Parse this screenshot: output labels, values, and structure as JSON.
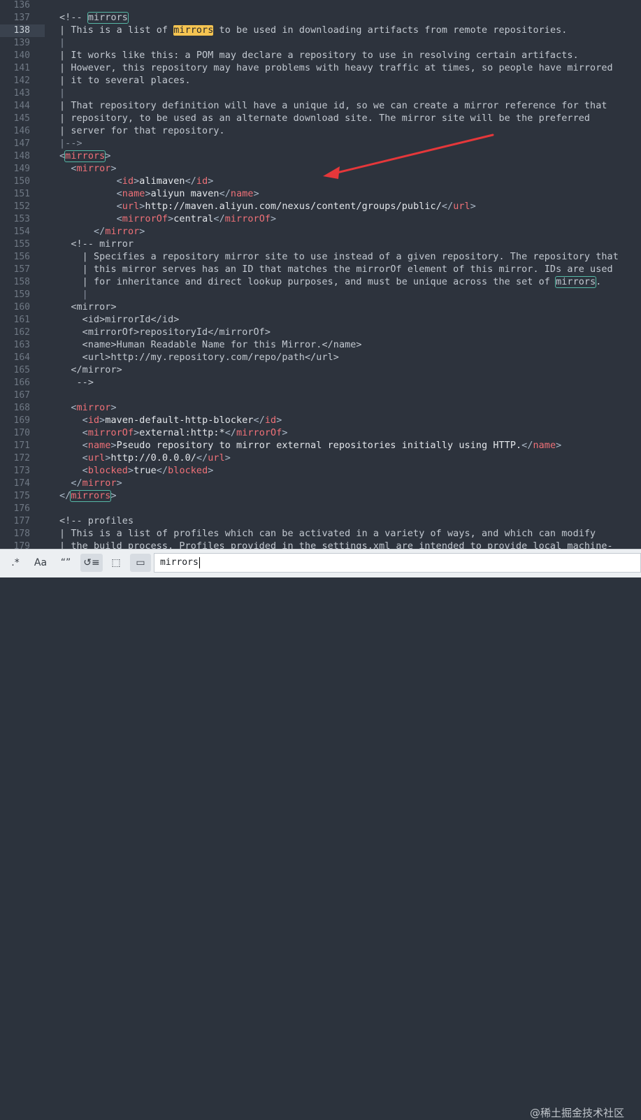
{
  "editor": {
    "lines": [
      {
        "n": "136"
      },
      {
        "n": "137"
      },
      {
        "n": "138"
      },
      {
        "n": "139"
      },
      {
        "n": "140"
      },
      {
        "n": "141"
      },
      {
        "n": "142"
      },
      {
        "n": "143"
      },
      {
        "n": "144"
      },
      {
        "n": "145"
      },
      {
        "n": "146"
      },
      {
        "n": "147"
      },
      {
        "n": "148"
      },
      {
        "n": "149"
      },
      {
        "n": "150"
      },
      {
        "n": "151"
      },
      {
        "n": "152"
      },
      {
        "n": "153"
      },
      {
        "n": "154"
      },
      {
        "n": "155"
      },
      {
        "n": "156"
      },
      {
        "n": "157"
      },
      {
        "n": "158"
      },
      {
        "n": "159"
      },
      {
        "n": "160"
      },
      {
        "n": "161"
      },
      {
        "n": "162"
      },
      {
        "n": "163"
      },
      {
        "n": "164"
      },
      {
        "n": "165"
      },
      {
        "n": "166"
      },
      {
        "n": "167"
      },
      {
        "n": "168"
      },
      {
        "n": "169"
      },
      {
        "n": "170"
      },
      {
        "n": "171"
      },
      {
        "n": "172"
      },
      {
        "n": "173"
      },
      {
        "n": "174"
      },
      {
        "n": "175"
      },
      {
        "n": "176"
      },
      {
        "n": "177"
      },
      {
        "n": "178"
      },
      {
        "n": "179"
      }
    ],
    "current_line": "138",
    "text": {
      "l137_open": "<!-- ",
      "mirrors": "mirrors",
      "l138_a": "| This is a list of ",
      "l138_b": " to be used in downloading artifacts from remote repositories.",
      "bar": "|",
      "l140": "| It works like this: a POM may declare a repository to use in resolving certain artifacts.",
      "l141": "| However, this repository may have problems with heavy traffic at times, so people have mirrored",
      "l142": "| it to several places.",
      "l144": "| That repository definition will have a unique id, so we can create a mirror reference for that",
      "l145": "| repository, to be used as an alternate download site. The mirror site will be the preferred",
      "l146": "| server for that repository.",
      "l147": "|-->",
      "lt": "<",
      "gt": ">",
      "ltslash": "</",
      "mirror": "mirror",
      "id": "id",
      "name": "name",
      "url": "url",
      "mirrorOf": "mirrorOf",
      "blocked": "blocked",
      "v_alimaven": "alimaven",
      "v_aliyun": "aliyun maven",
      "v_url": "http://maven.aliyun.com/nexus/content/groups/public/",
      "v_central": "central",
      "l155": "<!-- mirror",
      "l156": "| Specifies a repository mirror site to use instead of a given repository. The repository that",
      "l157": "| this mirror serves has an ID that matches the mirrorOf element of this mirror. IDs are used",
      "l158_a": "| for inheritance and direct lookup purposes, and must be unique across the set of ",
      "l158_b": ".",
      "l160": "<mirror>",
      "l161": "<id>mirrorId</id>",
      "l162": "<mirrorOf>repositoryId</mirrorOf>",
      "l163": "<name>Human Readable Name for this Mirror.</name>",
      "l164": "<url>http://my.repository.com/repo/path</url>",
      "l165": "</mirror>",
      "l166": "-->",
      "v_blocker": "maven-default-http-blocker",
      "v_external": "external:http:*",
      "v_pseudo": "Pseudo repository to mirror external repositories initially using HTTP.",
      "v_zero": "http://0.0.0.0/",
      "v_true": "true",
      "l177": "<!-- profiles",
      "l178": "| This is a list of profiles which can be activated in a variety of ways, and which can modify",
      "l179": "| the build process. Profiles provided in the settings.xml are intended to provide local machine-"
    }
  },
  "findbar": {
    "regex_label": ".*",
    "case_label": "Aa",
    "word_label": "“”",
    "wrap_label": "↺≡",
    "insel_label": "⬚",
    "highlight_label": "▭",
    "query": "mirrors"
  },
  "watermark": "@稀土掘金技术社区",
  "colors": {
    "background": "#2d333d",
    "tag": "#f07178",
    "find_highlight": "#f5c451",
    "match_outline": "#57b8a6",
    "arrow": "#e5373a"
  }
}
